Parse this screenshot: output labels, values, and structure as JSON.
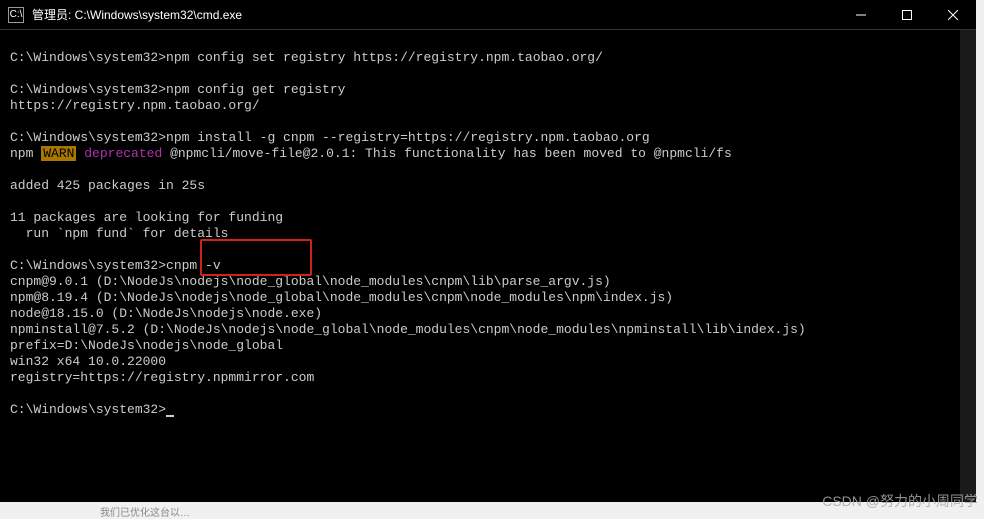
{
  "window": {
    "title": "管理员:  C:\\Windows\\system32\\cmd.exe",
    "icon_label": "C:\\"
  },
  "lines": {
    "l0_prompt": "C:\\Windows\\system32>",
    "l0_cmd": "npm config set registry https://registry.npm.taobao.org/",
    "l1_prompt": "C:\\Windows\\system32>",
    "l1_cmd": "npm config get registry",
    "l2": "https://registry.npm.taobao.org/",
    "l3_prompt": "C:\\Windows\\system32>",
    "l3_cmd": "npm install -g cnpm --registry=https://registry.npm.taobao.org",
    "l4_a": "npm ",
    "l4_warn": "WARN",
    "l4_dep": " deprecated ",
    "l4_b": "@npmcli/move-file@2.0.1: This functionality has been moved to @npmcli/fs",
    "l5": "added 425 packages in 25s",
    "l6": "11 packages are looking for funding",
    "l7": "  run `npm fund` for details",
    "l8_prompt": "C:\\Windows\\system32>",
    "l8_cmd": "cnpm -v",
    "l9": "cnpm@9.0.1 (D:\\NodeJs\\nodejs\\node_global\\node_modules\\cnpm\\lib\\parse_argv.js)",
    "l10": "npm@8.19.4 (D:\\NodeJs\\nodejs\\node_global\\node_modules\\cnpm\\node_modules\\npm\\index.js)",
    "l11": "node@18.15.0 (D:\\NodeJs\\nodejs\\node.exe)",
    "l12": "npminstall@7.5.2 (D:\\NodeJs\\nodejs\\node_global\\node_modules\\cnpm\\node_modules\\npminstall\\lib\\index.js)",
    "l13": "prefix=D:\\NodeJs\\nodejs\\node_global",
    "l14": "win32 x64 10.0.22000",
    "l15": "registry=https://registry.npmmirror.com",
    "l16_prompt": "C:\\Windows\\system32>"
  },
  "watermark": "CSDN @努力的小周同学",
  "taskbar_hint": "我们已优化这台以…"
}
